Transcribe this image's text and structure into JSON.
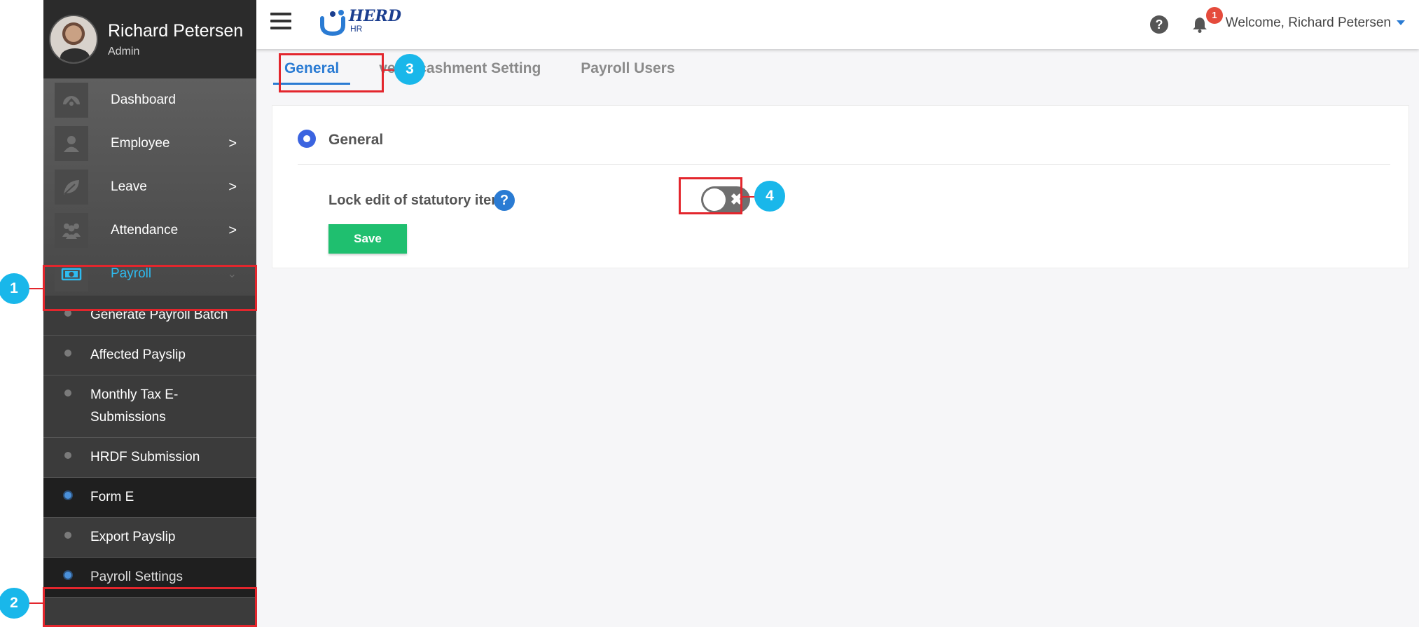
{
  "profile": {
    "name": "Richard Petersen",
    "role": "Admin"
  },
  "nav": [
    {
      "label": "Dashboard",
      "icon": "dashboard-icon",
      "chevron": ""
    },
    {
      "label": "Employee",
      "icon": "user-icon",
      "chevron": ">"
    },
    {
      "label": "Leave",
      "icon": "leaf-icon",
      "chevron": ">"
    },
    {
      "label": "Attendance",
      "icon": "group-icon",
      "chevron": ">"
    },
    {
      "label": "Payroll",
      "icon": "money-icon",
      "chevron": "⌄"
    }
  ],
  "payroll_submenu": [
    {
      "label": "Generate Payroll Batch"
    },
    {
      "label": "Affected Payslip"
    },
    {
      "label": "Monthly Tax E-Submissions"
    },
    {
      "label": "HRDF Submission"
    },
    {
      "label": "Form E"
    },
    {
      "label": "Export Payslip"
    },
    {
      "label": "Payroll Settings"
    }
  ],
  "header": {
    "logo_text": "HERD",
    "logo_sub": "HR",
    "notification_count": "1",
    "welcome_prefix": "Welcome,",
    "welcome_name": "Richard Petersen"
  },
  "tabs": [
    {
      "label": "General",
      "active": true
    },
    {
      "label": "ve Encashment Setting",
      "active": false
    },
    {
      "label": "Payroll Users",
      "active": false
    }
  ],
  "general": {
    "section_title": "General",
    "lock_label": "Lock edit of statutory items",
    "help_glyph": "?",
    "toggle_state": "off",
    "toggle_glyph": "✖",
    "save_label": "Save"
  },
  "annotations": [
    "1",
    "2",
    "3",
    "4"
  ],
  "colors": {
    "accent_blue": "#2a7bd3",
    "active_nav": "#2ebbf0",
    "save_green": "#1fbf6f",
    "badge_red": "#e54b3c",
    "annotation_red": "#e3262d",
    "annotation_badge": "#19b7ea"
  }
}
